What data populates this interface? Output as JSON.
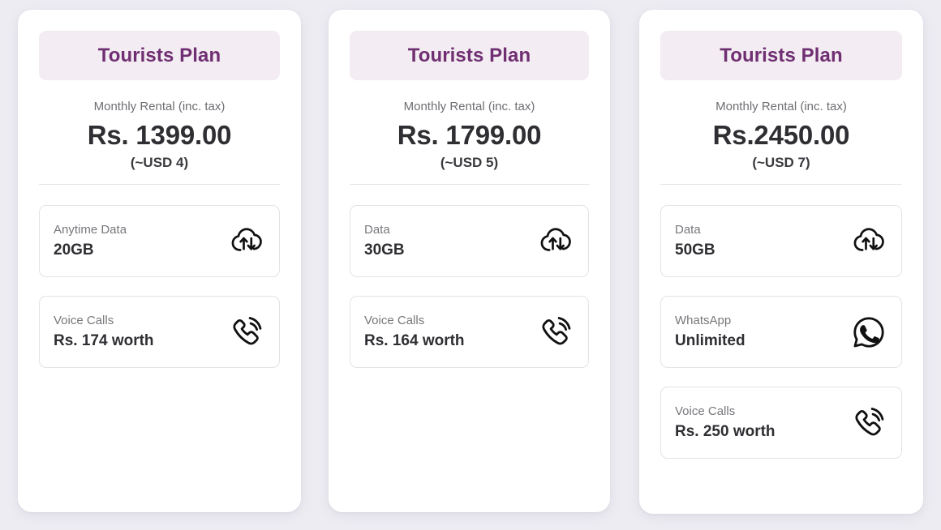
{
  "page": {
    "background_color": "#edecf2",
    "accent_color": "#702f72",
    "pill_background": "#f3ecf2"
  },
  "plans": [
    {
      "title": "Tourists Plan",
      "rental_label": "Monthly Rental (inc. tax)",
      "price": "Rs. 1399.00",
      "usd": "(~USD 4)",
      "features": [
        {
          "label": "Anytime Data",
          "value": "20GB",
          "icon": "cloud-data-transfer-icon"
        },
        {
          "label": "Voice Calls",
          "value": "Rs. 174 worth",
          "icon": "phone-call-icon"
        }
      ]
    },
    {
      "title": "Tourists Plan",
      "rental_label": "Monthly Rental (inc. tax)",
      "price": "Rs. 1799.00",
      "usd": "(~USD 5)",
      "features": [
        {
          "label": "Data",
          "value": "30GB",
          "icon": "cloud-data-transfer-icon"
        },
        {
          "label": "Voice Calls",
          "value": "Rs. 164 worth",
          "icon": "phone-call-icon"
        }
      ]
    },
    {
      "title": "Tourists Plan",
      "rental_label": "Monthly Rental (inc. tax)",
      "price": "Rs.2450.00",
      "usd": "(~USD 7)",
      "features": [
        {
          "label": "Data",
          "value": "50GB",
          "icon": "cloud-data-transfer-icon"
        },
        {
          "label": "WhatsApp",
          "value": "Unlimited",
          "icon": "whatsapp-icon"
        },
        {
          "label": "Voice Calls",
          "value": "Rs. 250 worth",
          "icon": "phone-call-icon"
        }
      ]
    }
  ]
}
